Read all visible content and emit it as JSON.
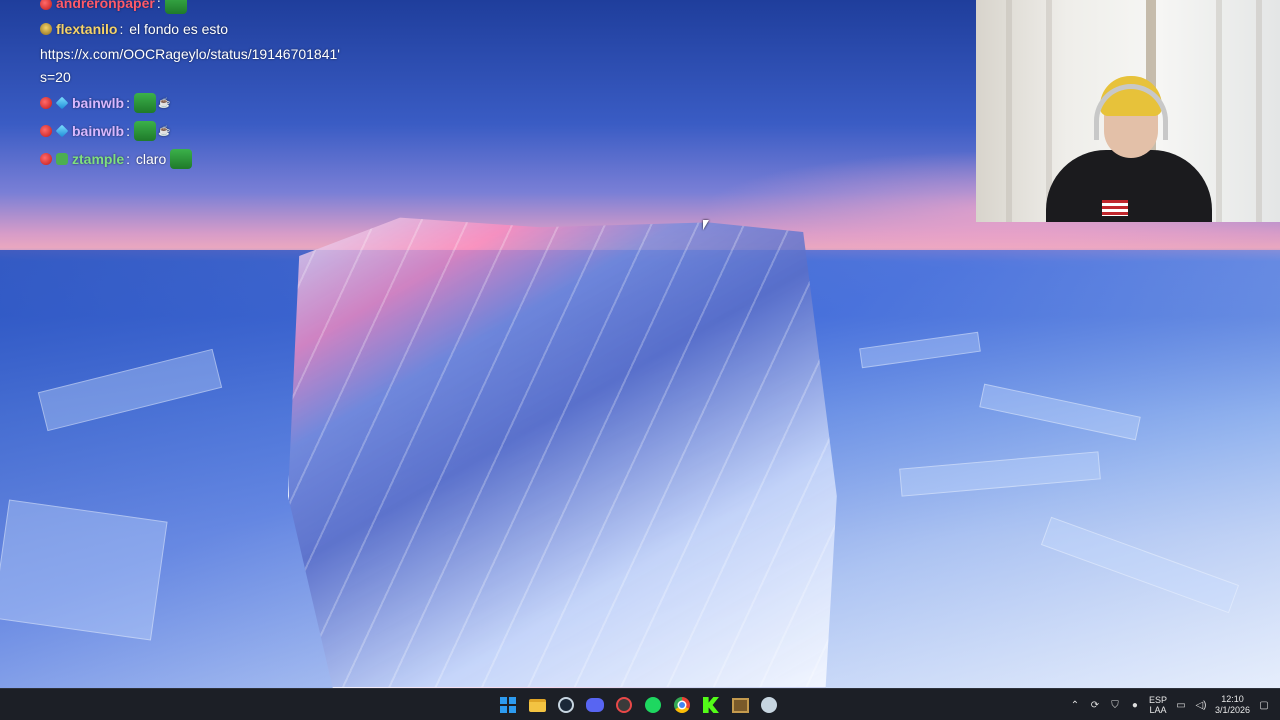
{
  "chat": {
    "messages": [
      {
        "user": "andreronpaper",
        "text": "",
        "user_color": "#ff5a6a",
        "badges": [
          "red-badge-icon"
        ],
        "emote": "green-emote-icon"
      },
      {
        "user": "flextanilo",
        "text": "el fondo es esto",
        "user_color": "#f5d36a",
        "badges": [
          "helmet-badge-icon"
        ]
      },
      {
        "url": "https://x.com/OOCRageylo/status/19146701841'",
        "url_cont": "s=20"
      },
      {
        "user": "bainwlb",
        "text": "",
        "user_color": "#d9b8ff",
        "badges": [
          "red-badge-icon",
          "cube-badge-icon"
        ],
        "emote": "green-emote-with-cup-icon"
      },
      {
        "user": "bainwlb",
        "text": "",
        "user_color": "#d9b8ff",
        "badges": [
          "red-badge-icon",
          "cube-badge-icon"
        ],
        "emote": "green-emote-with-cup-icon"
      },
      {
        "user": "ztample",
        "text": "claro",
        "user_color": "#7fe07f",
        "badges": [
          "red-badge-icon",
          "bot-badge-icon"
        ],
        "emote": "green-emote-icon"
      }
    ]
  },
  "taskbar": {
    "apps": [
      {
        "name": "start",
        "icon": "windows-start-icon"
      },
      {
        "name": "file-explorer",
        "icon": "folder-icon"
      },
      {
        "name": "steam",
        "icon": "steam-icon"
      },
      {
        "name": "discord",
        "icon": "discord-icon"
      },
      {
        "name": "obs",
        "icon": "record-icon"
      },
      {
        "name": "spotify",
        "icon": "spotify-icon"
      },
      {
        "name": "chrome",
        "icon": "chrome-icon"
      },
      {
        "name": "kick",
        "icon": "kick-icon"
      },
      {
        "name": "minecraft",
        "icon": "crate-icon"
      },
      {
        "name": "steam-2",
        "icon": "steam-icon"
      }
    ],
    "tray": {
      "lang_top": "ESP",
      "lang_bottom": "LAA",
      "time": "12:10",
      "date": "3/1/2026"
    }
  }
}
